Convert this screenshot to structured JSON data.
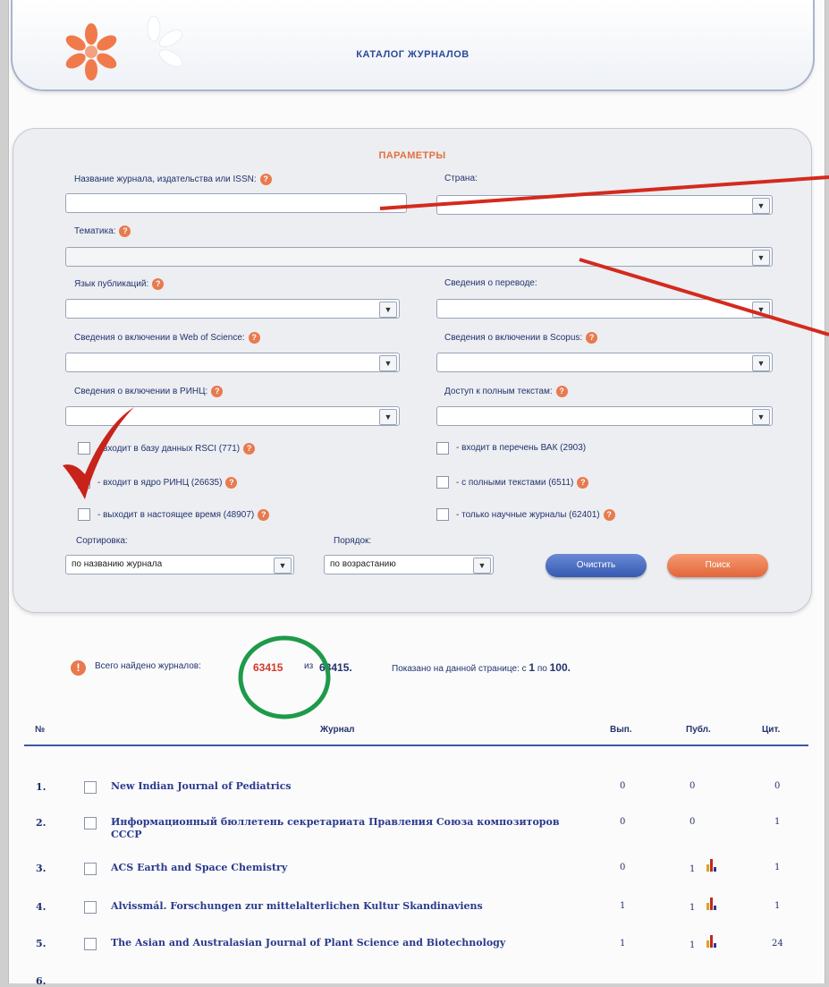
{
  "header": {
    "title": "КАТАЛОГ ЖУРНАЛОВ"
  },
  "params": {
    "title": "ПАРАМЕТРЫ",
    "journal_label": "Название журнала, издательства или ISSN:",
    "country_label": "Страна:",
    "topic_label": "Тематика:",
    "language_label": "Язык публикаций:",
    "translation_label": "Сведения о переводе:",
    "wos_label": "Сведения о включении в Web of Science:",
    "scopus_label": "Сведения о включении в Scopus:",
    "rinc_label": "Сведения о включении в РИНЦ:",
    "fulltext_label": "Доступ к полным текстам:",
    "checkboxes": [
      "- входит в базу данных RSCI (771)",
      "- входит в ядро РИНЦ (26635)",
      "- выходит в настоящее время (48907)",
      "- входит в перечень ВАК (2903)",
      "- с полными текстами (6511)",
      "- только научные журналы (62401)"
    ],
    "sort_label": "Сортировка:",
    "sort_value": "по названию журнала",
    "order_label": "Порядок:",
    "order_value": "по возрастанию",
    "clear_button": "Очистить",
    "search_button": "Поиск",
    "help_glyph": "?"
  },
  "results": {
    "info_glyph": "!",
    "found_prefix": "Всего найдено журналов:",
    "found_count": "63415",
    "found_of": "из",
    "found_total": "63415.",
    "shown_prefix": "Показано на данной странице: с",
    "shown_from": "1",
    "shown_to_word": "по",
    "shown_to": "100."
  },
  "table": {
    "headers": {
      "num": "№",
      "journal": "Журнал",
      "issues": "Вып.",
      "pubs": "Публ.",
      "cit": "Цит."
    },
    "rows": [
      {
        "num": "1.",
        "title": "New Indian Journal of Pediatrics",
        "issues": "0",
        "pubs": "0",
        "cit": "0",
        "chart": false
      },
      {
        "num": "2.",
        "title": "Информационный бюллетень секретариата Правления Союза композиторов СССР",
        "issues": "0",
        "pubs": "0",
        "cit": "1",
        "chart": false
      },
      {
        "num": "3.",
        "title": "ACS Earth and Space Chemistry",
        "issues": "0",
        "pubs": "1",
        "cit": "1",
        "chart": true
      },
      {
        "num": "4.",
        "title": "Alvissmál. Forschungen zur mittelalterlichen Kultur Skandinaviens",
        "issues": "1",
        "pubs": "1",
        "cit": "1",
        "chart": true
      },
      {
        "num": "5.",
        "title": "The Asian and Australasian Journal of Plant Science and Biotechnology",
        "issues": "1",
        "pubs": "1",
        "cit": "24",
        "chart": true
      }
    ]
  },
  "colors": {
    "accent_orange": "#e3703e",
    "accent_blue": "#2a4a9c",
    "annotation_red": "#d42a1e",
    "annotation_green": "#1e9a4a"
  }
}
